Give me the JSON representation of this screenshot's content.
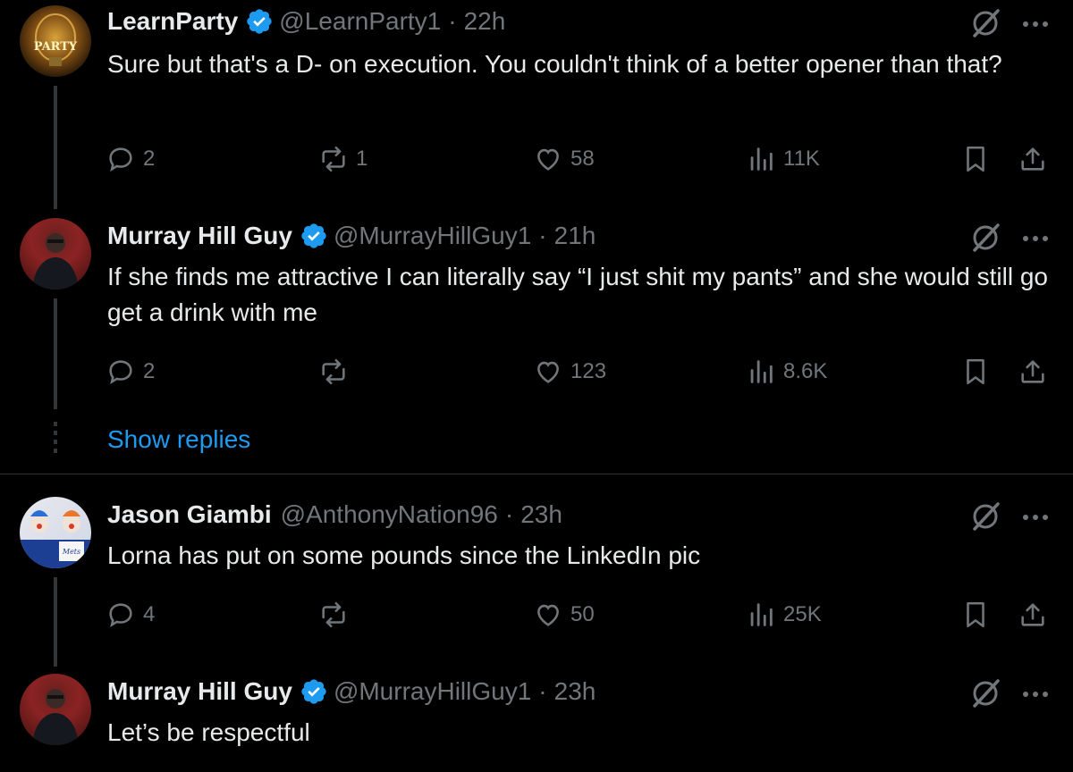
{
  "tweets": [
    {
      "name": "LearnParty",
      "handle": "@LearnParty1",
      "sep": "·",
      "time": "22h",
      "verified": true,
      "text": "Sure but that's a D- on execution. You couldn't think of a better opener than that?",
      "avatar_text": "PARTY",
      "replies": "2",
      "reposts": "1",
      "likes": "58",
      "views": "11K"
    },
    {
      "name": "Murray Hill Guy",
      "handle": "@MurrayHillGuy1",
      "sep": "·",
      "time": "21h",
      "verified": true,
      "text": "If she finds me attractive I can literally say “I just shit my pants” and she would still go get a drink with me",
      "replies": "2",
      "reposts": "",
      "likes": "123",
      "views": "8.6K"
    },
    {
      "name": "Jason Giambi",
      "handle": "@AnthonyNation96",
      "sep": "·",
      "time": "23h",
      "verified": false,
      "text": "Lorna has put on some pounds since the LinkedIn pic",
      "replies": "4",
      "reposts": "",
      "likes": "50",
      "views": "25K"
    },
    {
      "name": "Murray Hill Guy",
      "handle": "@MurrayHillGuy1",
      "sep": "·",
      "time": "23h",
      "verified": true,
      "text": "Let’s be respectful"
    }
  ],
  "show_replies_label": "Show replies",
  "icons": {
    "verified": "verified-badge-icon",
    "grok": "grok-icon",
    "more": "more-icon",
    "reply": "reply-icon",
    "repost": "repost-icon",
    "like": "heart-icon",
    "views": "views-icon",
    "bookmark": "bookmark-icon",
    "share": "share-icon"
  },
  "colors": {
    "background": "#000000",
    "text": "#e7e9ea",
    "muted": "#71767b",
    "accent": "#1d9bf0",
    "verified": "#1d9bf0"
  }
}
